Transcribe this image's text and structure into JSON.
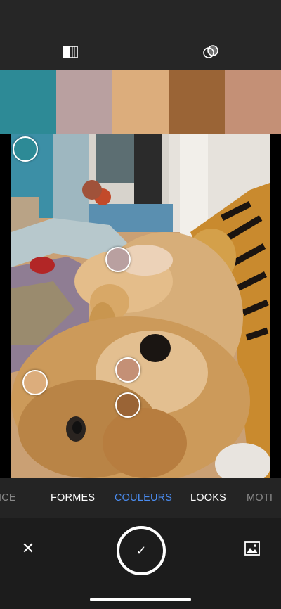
{
  "toolbar": {
    "compare_icon": "split-compare-icon",
    "blend_icon": "overlap-circles-icon"
  },
  "palette": {
    "swatches": [
      {
        "color": "#2d8a96"
      },
      {
        "color": "#b9a0a0"
      },
      {
        "color": "#dcad7c"
      },
      {
        "color": "#9a6436"
      },
      {
        "color": "#c49076"
      }
    ]
  },
  "photo": {
    "description_icon": "photo-dog-on-bed"
  },
  "samplers": [
    {
      "color": "#2d8a96"
    },
    {
      "color": "#b9a0a0"
    },
    {
      "color": "#dcad7c"
    },
    {
      "color": "#c49076"
    },
    {
      "color": "#9a6436"
    }
  ],
  "modes": {
    "tabs": [
      {
        "label": "ICE"
      },
      {
        "label": "FORMES"
      },
      {
        "label": "COULEURS"
      },
      {
        "label": "LOOKS"
      },
      {
        "label": "MOTI"
      }
    ],
    "active": "COULEURS"
  },
  "actions": {
    "close_label": "✕",
    "confirm_label": "✓",
    "gallery_icon": "image-gallery-icon"
  },
  "colors": {
    "accent": "#4a8cf0",
    "background": "#1c1c1c",
    "toolbar": "#262626"
  }
}
